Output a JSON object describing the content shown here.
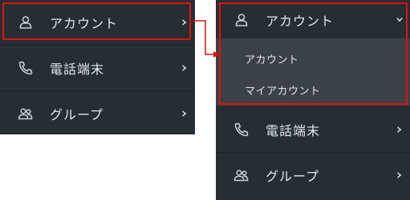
{
  "left_menu": {
    "items": [
      {
        "label": "アカウント",
        "icon": "user-icon"
      },
      {
        "label": "電話端末",
        "icon": "phone-icon"
      },
      {
        "label": "グループ",
        "icon": "group-icon"
      }
    ]
  },
  "right_menu": {
    "items": [
      {
        "label": "アカウント",
        "icon": "user-icon",
        "expanded": true,
        "submenu": [
          {
            "label": "アカウント"
          },
          {
            "label": "マイアカウント"
          }
        ]
      },
      {
        "label": "電話端末",
        "icon": "phone-icon"
      },
      {
        "label": "グループ",
        "icon": "group-icon"
      }
    ]
  },
  "colors": {
    "panel_bg": "#262d33",
    "submenu_bg": "#3b4147",
    "highlight": "#e01010",
    "text": "#e4e7ea"
  }
}
